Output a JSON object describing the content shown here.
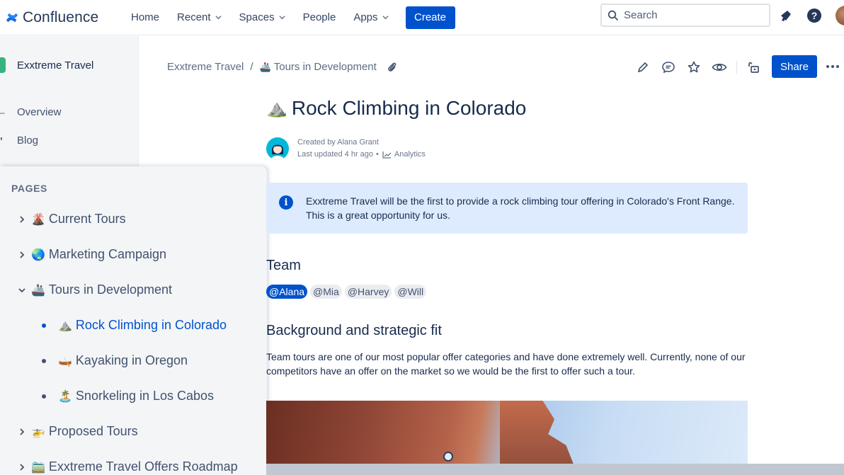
{
  "topnav": {
    "brand": "Confluence",
    "items": [
      {
        "label": "Home",
        "dropdown": false
      },
      {
        "label": "Recent",
        "dropdown": true
      },
      {
        "label": "Spaces",
        "dropdown": true
      },
      {
        "label": "People",
        "dropdown": false
      },
      {
        "label": "Apps",
        "dropdown": true
      }
    ],
    "create_label": "Create",
    "search_placeholder": "Search"
  },
  "sidebar": {
    "space_name": "Exxtreme Travel",
    "links": [
      {
        "label": "Overview",
        "icon": "overview-icon"
      },
      {
        "label": "Blog",
        "icon": "blog-icon"
      }
    ]
  },
  "pages": {
    "heading": "PAGES",
    "items": [
      {
        "label": "Current Tours",
        "emoji": "🌋",
        "kind": "collapsed",
        "level": 0
      },
      {
        "label": "Marketing Campaign",
        "emoji": "🌏",
        "kind": "collapsed",
        "level": 0
      },
      {
        "label": "Tours in Development",
        "emoji": "🚢",
        "kind": "expanded",
        "level": 0
      },
      {
        "label": "Rock Climbing in Colorado",
        "emoji": "⛰️",
        "kind": "leaf",
        "level": 1,
        "active": true
      },
      {
        "label": "Kayaking in Oregon",
        "emoji": "🛶",
        "kind": "leaf",
        "level": 1
      },
      {
        "label": "Snorkeling in Los Cabos",
        "emoji": "🏝️",
        "kind": "leaf",
        "level": 1
      },
      {
        "label": "Proposed Tours",
        "emoji": "🚁",
        "kind": "collapsed",
        "level": 0
      },
      {
        "label": "Exxtreme Travel Offers Roadmap",
        "emoji": "🚞",
        "kind": "collapsed",
        "level": 0
      }
    ]
  },
  "breadcrumb": {
    "space": "Exxtreme Travel",
    "separator": "/",
    "parent_emoji": "🚢",
    "parent": "Tours in Development"
  },
  "toolbar": {
    "share_label": "Share",
    "icons": [
      "edit-icon",
      "comment-icon",
      "star-icon",
      "watch-icon",
      "restrictions-icon",
      "more-icon"
    ]
  },
  "page": {
    "title_emoji": "⛰️",
    "title": "Rock Climbing in Colorado",
    "created_by": "Created by Alana Grant",
    "last_updated": "Last updated 4 hr ago",
    "meta_separator": "•",
    "analytics_label": "Analytics",
    "info_icon_glyph": "i",
    "info_text": "Exxtreme Travel will be the first to provide a rock climbing tour offering in Colorado's Front Range. This is a great opportunity for us.",
    "team_heading": "Team",
    "mentions": [
      "@Alana",
      "@Mia",
      "@Harvey",
      "@Will"
    ],
    "background_heading": "Background and strategic fit",
    "background_text": "Team tours are one of our most popular offer categories and have done extremely well. Currently, none of our competitors have an offer on the market so we would be the first to offer such a tour."
  },
  "colors": {
    "primary": "#0052cc",
    "info_bg": "#deebff",
    "sidebar_bg": "#f4f5f7",
    "space_logo": "#36b37e",
    "avatar_bg": "#00b8d9"
  }
}
